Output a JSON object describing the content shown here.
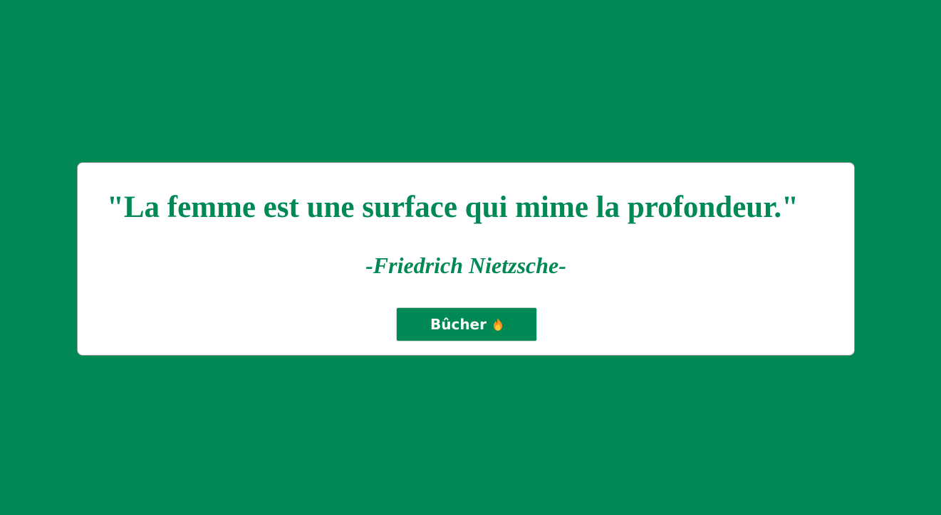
{
  "quote": {
    "text": "\"La femme est une surface qui mime la profondeur.\"",
    "author": "-Friedrich Nietzsche-"
  },
  "button": {
    "label": "Bûcher",
    "icon": "fire-icon"
  },
  "colors": {
    "background": "#008855",
    "card": "#ffffff",
    "accent": "#008855",
    "button_text": "#ffffff"
  }
}
